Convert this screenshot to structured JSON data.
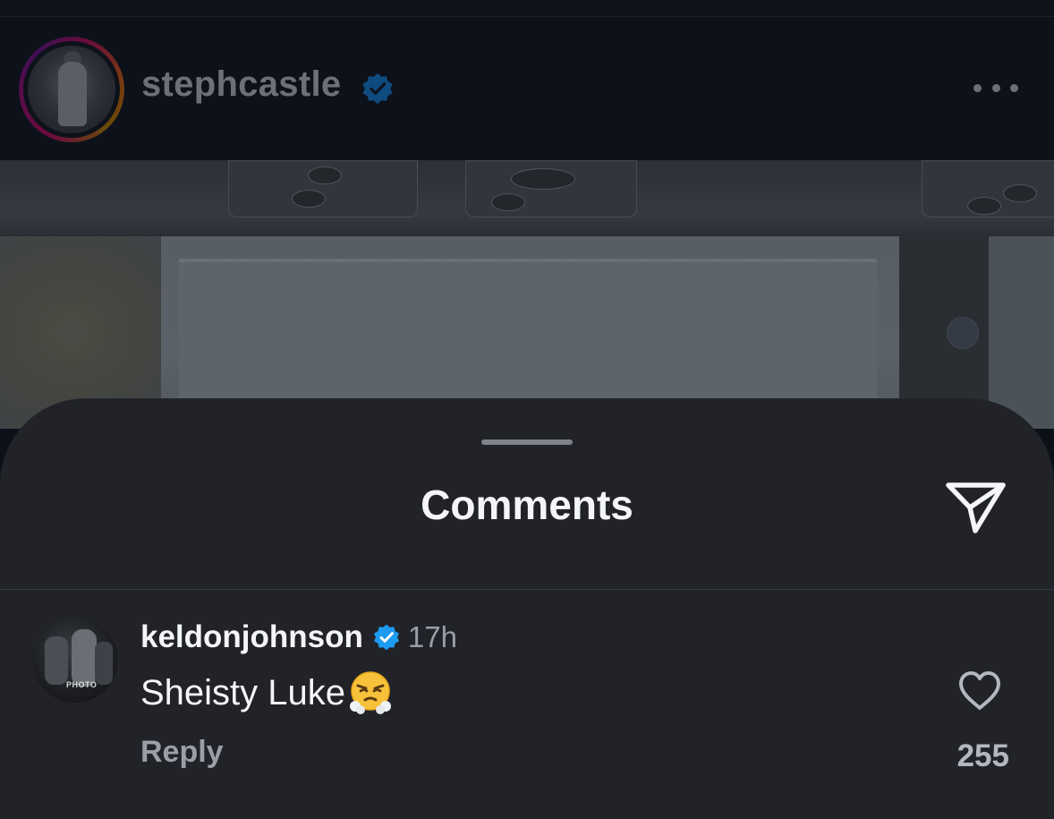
{
  "post": {
    "username": "stephcastle",
    "verified": true
  },
  "sheet": {
    "title": "Comments"
  },
  "comments": [
    {
      "username": "keldonjohnson",
      "verified": true,
      "time": "17h",
      "text": "Sheisty Luke",
      "emoji": "face-with-steam-from-nose",
      "reply_label": "Reply",
      "like_count": "255",
      "avatar_text": "PHOTO"
    }
  ],
  "icons": {
    "verified_color": "#1d9bf0",
    "verified_color_dimmed": "#0e4c80"
  }
}
